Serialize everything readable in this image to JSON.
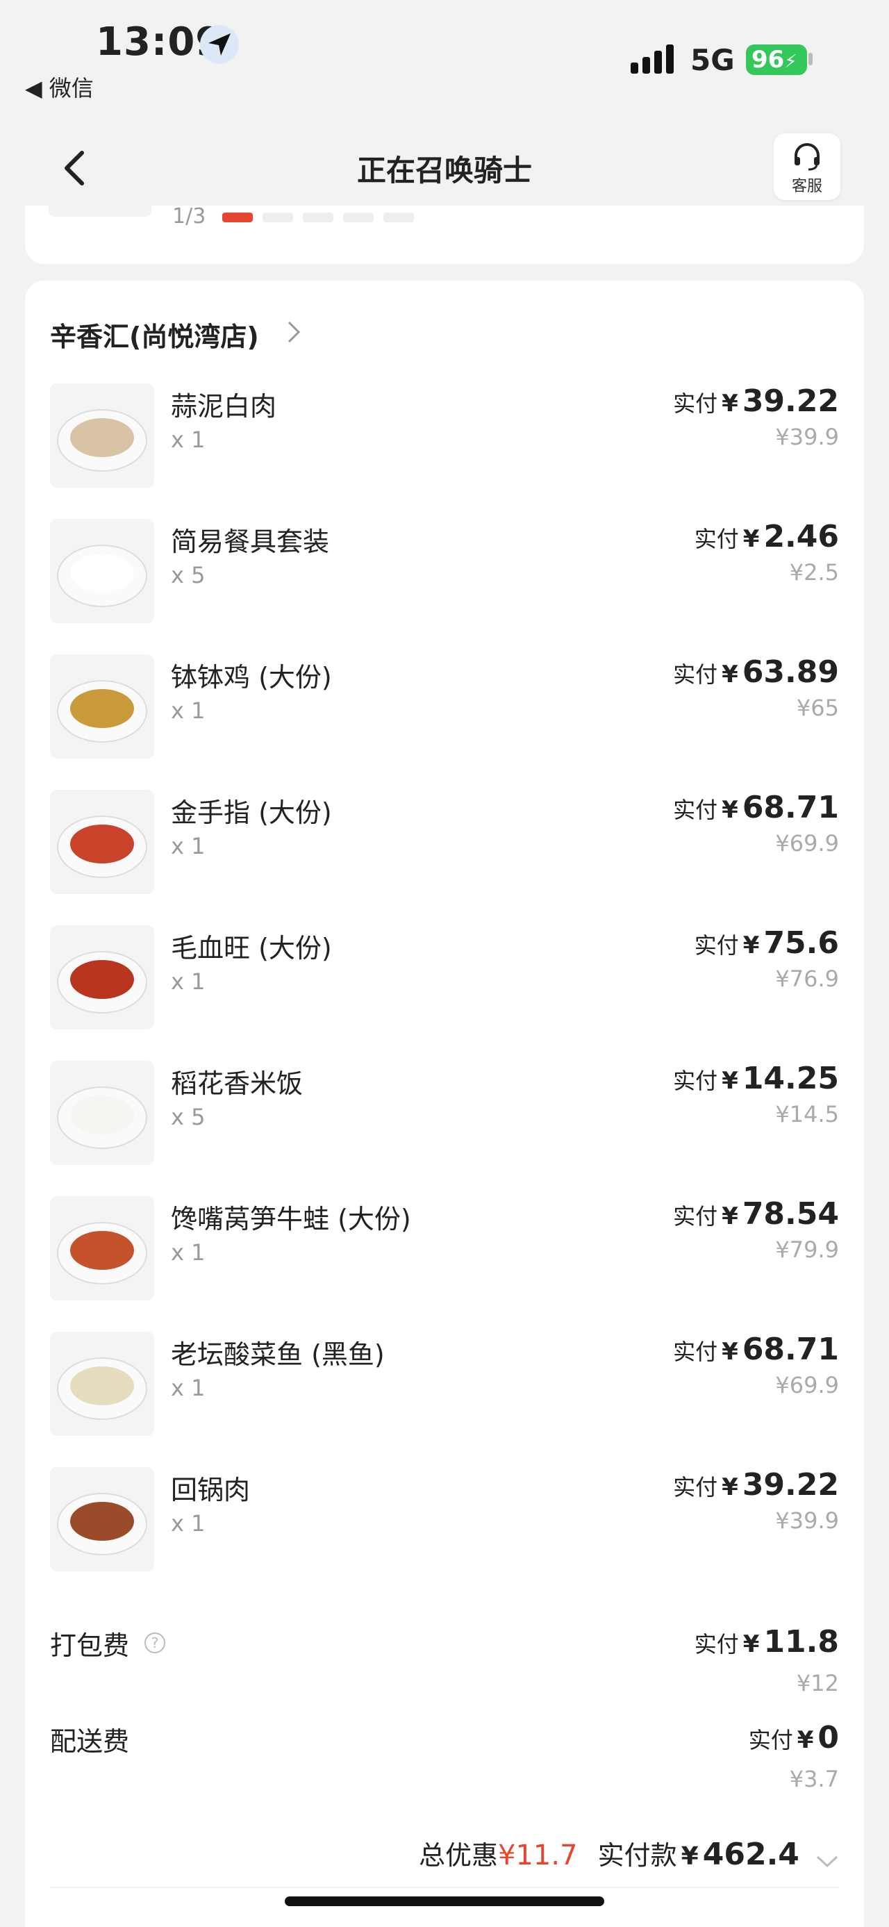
{
  "status_bar": {
    "time": "13:09",
    "back_app": "◀ 微信",
    "network": "5G",
    "battery": "96"
  },
  "nav": {
    "title": "正在召唤骑士",
    "service_label": "客服"
  },
  "top_card": {
    "fraction": "1/3"
  },
  "store": {
    "name": "辛香汇(尚悦湾店)"
  },
  "items": [
    {
      "name": "蒜泥白肉",
      "qty": "x 1",
      "pay_label": "实付",
      "currency": "¥",
      "paid": "39.22",
      "original": "¥39.9",
      "thumb_color": "#d8c3a5"
    },
    {
      "name": "简易餐具套装",
      "qty": "x 5",
      "pay_label": "实付",
      "currency": "¥",
      "paid": "2.46",
      "original": "¥2.5",
      "thumb_color": "#ffffff"
    },
    {
      "name": "钵钵鸡 (大份)",
      "qty": "x 1",
      "pay_label": "实付",
      "currency": "¥",
      "paid": "63.89",
      "original": "¥65",
      "thumb_color": "#c89a3a"
    },
    {
      "name": "金手指 (大份)",
      "qty": "x 1",
      "pay_label": "实付",
      "currency": "¥",
      "paid": "68.71",
      "original": "¥69.9",
      "thumb_color": "#c8432a"
    },
    {
      "name": "毛血旺 (大份)",
      "qty": "x 1",
      "pay_label": "实付",
      "currency": "¥",
      "paid": "75.6",
      "original": "¥76.9",
      "thumb_color": "#b8351f"
    },
    {
      "name": "稻花香米饭",
      "qty": "x 5",
      "pay_label": "实付",
      "currency": "¥",
      "paid": "14.25",
      "original": "¥14.5",
      "thumb_color": "#f5f5f2"
    },
    {
      "name": "馋嘴莴笋牛蛙 (大份)",
      "qty": "x 1",
      "pay_label": "实付",
      "currency": "¥",
      "paid": "78.54",
      "original": "¥79.9",
      "thumb_color": "#c4532b"
    },
    {
      "name": "老坛酸菜鱼 (黑鱼)",
      "qty": "x 1",
      "pay_label": "实付",
      "currency": "¥",
      "paid": "68.71",
      "original": "¥69.9",
      "thumb_color": "#e6dcc0"
    },
    {
      "name": "回锅肉",
      "qty": "x 1",
      "pay_label": "实付",
      "currency": "¥",
      "paid": "39.22",
      "original": "¥39.9",
      "thumb_color": "#9a4b2a"
    }
  ],
  "fees": [
    {
      "name": "打包费",
      "has_help": true,
      "pay_label": "实付",
      "currency": "¥",
      "paid": "11.8",
      "original": "¥12"
    },
    {
      "name": "配送费",
      "has_help": false,
      "pay_label": "实付",
      "currency": "¥",
      "paid": "0",
      "original": "¥3.7"
    }
  ],
  "summary": {
    "discount_label": "总优惠",
    "discount_value": "¥11.7",
    "total_label": "实付款",
    "currency": "¥",
    "total_value": "462.4"
  },
  "colors": {
    "accent_red": "#e5462f",
    "battery_green": "#34c759"
  }
}
